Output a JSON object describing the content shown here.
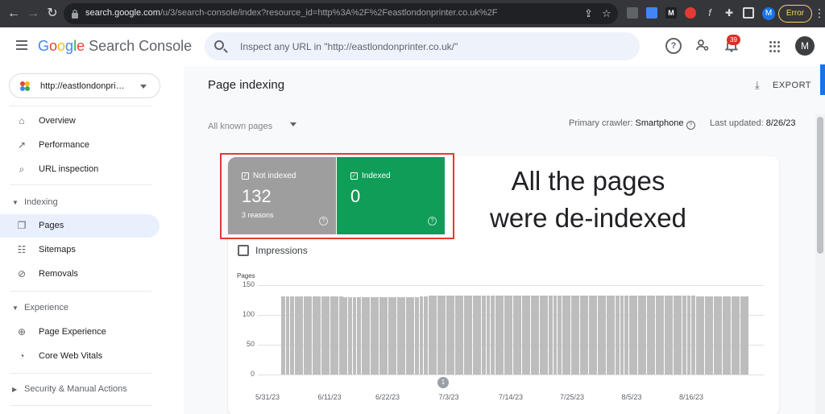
{
  "browser": {
    "url_host": "search.google.com",
    "url_path": "/u/3/search-console/index?resource_id=http%3A%2F%2Feastlondonprinter.co.uk%2F",
    "profile_initial": "M",
    "error_label": "Error"
  },
  "header": {
    "brand_g": "G",
    "brand_o1": "o",
    "brand_o2": "o",
    "brand_g2": "g",
    "brand_l": "l",
    "brand_e": "e",
    "brand_product": "Search Console",
    "search_placeholder": "Inspect any URL in \"http://eastlondonprinter.co.uk/\"",
    "notifications_count": "39",
    "avatar_initial": "M"
  },
  "sidebar": {
    "property": "http://eastlondonpri…",
    "items_top": [
      {
        "label": "Overview",
        "icon": "home-icon"
      },
      {
        "label": "Performance",
        "icon": "trending-up-icon"
      },
      {
        "label": "URL inspection",
        "icon": "search-icon"
      }
    ],
    "indexing_section": "Indexing",
    "indexing_items": [
      {
        "label": "Pages",
        "icon": "pages-icon",
        "active": true
      },
      {
        "label": "Sitemaps",
        "icon": "sitemap-icon"
      },
      {
        "label": "Removals",
        "icon": "removals-icon"
      }
    ],
    "experience_section": "Experience",
    "experience_items": [
      {
        "label": "Page Experience",
        "icon": "plus-circle-icon"
      },
      {
        "label": "Core Web Vitals",
        "icon": "gauge-icon"
      }
    ],
    "security_section": "Security & Manual Actions"
  },
  "main": {
    "title": "Page indexing",
    "export_label": "EXPORT",
    "filter_label": "All known pages",
    "crawler_prefix": "Primary crawler:",
    "crawler_value": "Smartphone",
    "updated_prefix": "Last updated:",
    "updated_value": "8/26/23",
    "not_indexed": {
      "label": "Not indexed",
      "value": "132",
      "sub": "3 reasons"
    },
    "indexed": {
      "label": "Indexed",
      "value": "0"
    },
    "annotation_line1": "All the pages",
    "annotation_line2": "were de-indexed",
    "impressions_label": "Impressions"
  },
  "colors": {
    "not_indexed": "#9e9e9e",
    "indexed": "#0f9d58",
    "annotation_box": "#e53935",
    "accent": "#1a73e8"
  },
  "chart_data": {
    "type": "bar",
    "ylabel": "Pages",
    "ylim": [
      0,
      150
    ],
    "yticks": [
      "150",
      "100",
      "50",
      "0"
    ],
    "xticks": [
      "5/31/23",
      "6/11/23",
      "6/22/23",
      "7/3/23",
      "7/14/23",
      "7/25/23",
      "8/5/23",
      "8/16/23"
    ],
    "marker_label": "1",
    "series": [
      {
        "color": "#bdbdbd",
        "values": [
          131,
          131,
          131,
          131,
          131,
          131,
          131,
          131,
          131,
          131,
          131,
          131,
          131,
          131,
          130,
          130,
          130,
          130,
          130,
          130,
          130,
          130,
          130,
          130,
          130,
          130,
          130,
          130,
          130,
          130,
          130,
          131,
          131,
          133,
          133,
          133,
          133,
          133,
          133,
          133,
          133,
          133,
          133,
          133,
          133,
          133,
          133,
          133,
          133,
          133,
          133,
          133,
          132,
          132,
          132,
          132,
          132,
          132,
          132,
          132,
          132,
          132,
          132,
          132,
          132,
          132,
          132,
          132,
          132,
          132,
          132,
          132,
          132,
          132,
          132,
          132,
          132,
          132,
          132,
          132,
          132,
          132,
          132,
          132,
          132,
          132,
          132,
          132,
          132,
          132,
          132,
          132,
          132,
          131,
          131,
          131,
          131,
          131,
          131,
          131,
          131,
          131,
          131,
          131,
          131
        ]
      }
    ]
  }
}
